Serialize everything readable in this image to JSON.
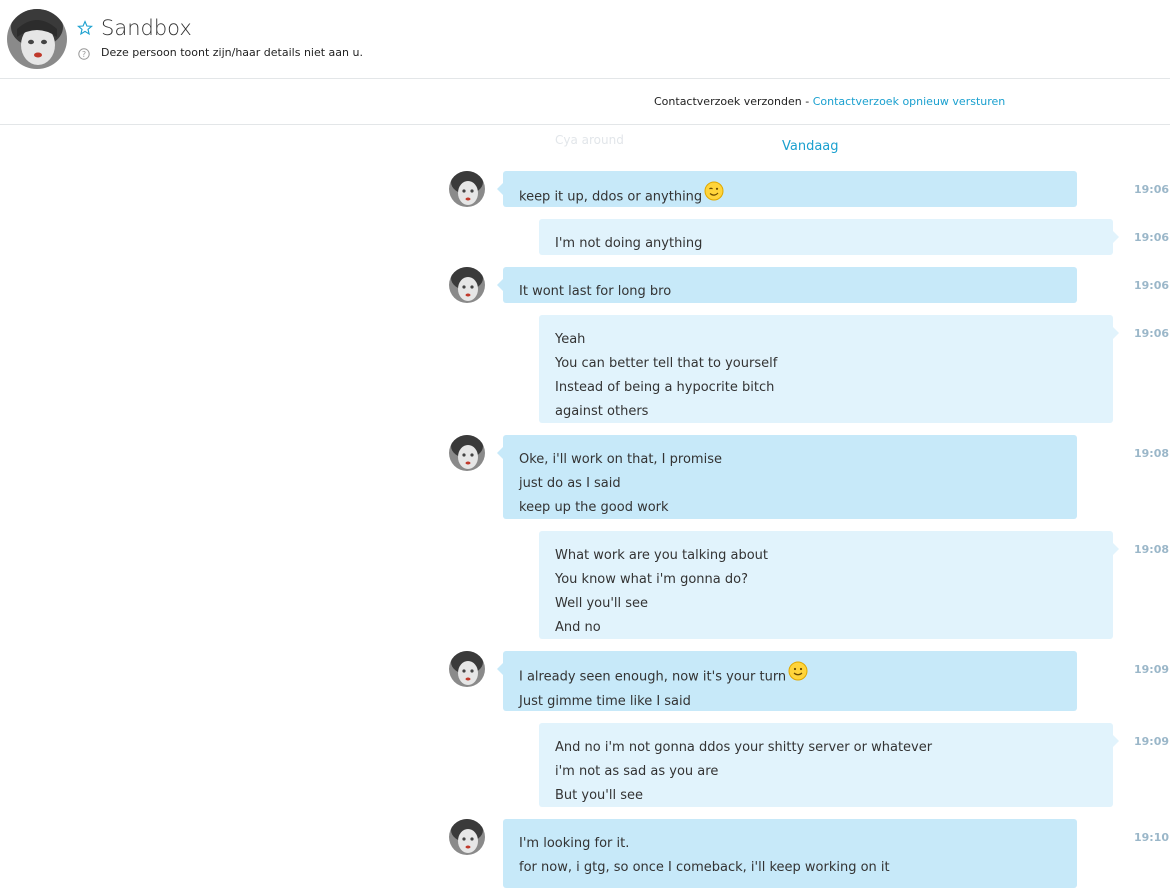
{
  "header": {
    "contact_name": "Sandbox",
    "status_text": "Deze persoon toont zijn/haar details niet aan u."
  },
  "contact_bar": {
    "sent_text": "Contactverzoek verzonden - ",
    "resend_link": "Contactverzoek opnieuw versturen"
  },
  "faded_preview": "Cya around",
  "day_separator": "Vandaag",
  "messages": [
    {
      "from": "contact",
      "lines": [
        "keep it up, ddos or anything"
      ],
      "emoji": "wink",
      "time": "19:06"
    },
    {
      "from": "me",
      "lines": [
        "I'm not doing anything"
      ],
      "time": "19:06"
    },
    {
      "from": "contact",
      "lines": [
        "It wont last for long bro"
      ],
      "time": "19:06"
    },
    {
      "from": "me",
      "lines": [
        "Yeah",
        "You can better tell that to yourself",
        "Instead of being a hypocrite bitch",
        "against others"
      ],
      "time": "19:06"
    },
    {
      "from": "contact",
      "lines": [
        "Oke, i'll work on that, I promise",
        "just do as I said",
        "keep up the good work"
      ],
      "time": "19:08"
    },
    {
      "from": "me",
      "lines": [
        "What work are you talking about",
        "You know what i'm gonna do?",
        "Well you'll see",
        "And no"
      ],
      "time": "19:08"
    },
    {
      "from": "contact",
      "lines": [
        "I already seen enough, now it's your turn",
        "Just gimme time like I said"
      ],
      "emoji": "smile",
      "time": "19:09"
    },
    {
      "from": "me",
      "lines": [
        "And no i'm not gonna ddos your shitty server or whatever",
        "i'm not as sad as you are",
        "But you'll see"
      ],
      "time": "19:09"
    },
    {
      "from": "contact",
      "lines": [
        "I'm looking for it.",
        "for now, i gtg, so once I comeback, i'll keep working on it"
      ],
      "time": "19:10"
    }
  ],
  "colors": {
    "accent": "#1aa0cf",
    "incoming_bubble": "#c7e9f9",
    "outgoing_bubble": "#e1f3fc",
    "timestamp": "#9bb7c9"
  }
}
